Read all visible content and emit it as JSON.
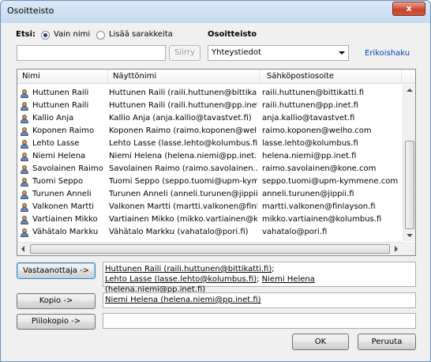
{
  "window": {
    "title": "Osoitteisto",
    "close": "x"
  },
  "search": {
    "label": "Etsi:",
    "opt_name": "Vain nimi",
    "opt_more": "Lisää sarakkeita",
    "value": "",
    "go_label": "Siirry"
  },
  "book": {
    "label": "Osoitteisto",
    "selected": "Yhteystiedot",
    "advanced": "Erikoishaku"
  },
  "columns": [
    "Nimi",
    "Näyttönimi",
    "Sähköpostiosoite"
  ],
  "rows": [
    {
      "name": "Huttunen Raili",
      "display": "Huttunen Raili (raili.huttunen@bittika...",
      "email": "raili.huttunen@bittikatti.fi"
    },
    {
      "name": "Huttunen Raili",
      "display": "Huttunen Raili (raili.huttunen@pp.inet....",
      "email": "raili.huttunen@pp.inet.fi"
    },
    {
      "name": "Kallio Anja",
      "display": "Kallio Anja (anja.kallio@tavastvet.fi)",
      "email": "anja.kallio@tavastvet.fi"
    },
    {
      "name": "Koponen Raimo",
      "display": "Koponen Raimo (raimo.koponen@wel...",
      "email": "raimo.koponen@welho.com"
    },
    {
      "name": "Lehto Lasse",
      "display": "Lehto Lasse (lasse.lehto@kolumbus.fi)",
      "email": "lasse.lehto@kolumbus.fi"
    },
    {
      "name": "Niemi Helena",
      "display": "Niemi Helena (helena.niemi@pp.inet.fi)",
      "email": "helena.niemi@pp.inet.fi"
    },
    {
      "name": "Savolainen Raimo",
      "display": "Savolainen Raimo (raimo.savolainen....",
      "email": "raimo.savolainen@kone.com"
    },
    {
      "name": "Tuomi Seppo",
      "display": "Tuomi Seppo (seppo.tuomi@upm-kym...",
      "email": "seppo.tuomi@upm-kymmene.com"
    },
    {
      "name": "Turunen Anneli",
      "display": "Turunen Anneli (anneli.turunen@jippii...",
      "email": "anneli.turunen@jippii.fi"
    },
    {
      "name": "Valkonen Martti",
      "display": "Valkonen Martti (martti.valkonen@finl...",
      "email": "martti.valkonen@finlayson.fi"
    },
    {
      "name": "Vartiainen Mikko",
      "display": "Vartiainen Mikko (mikko.vartiainen@k...",
      "email": "mikko.vartiainen@kolumbus.fi"
    },
    {
      "name": "Vähätalo Markku",
      "display": "Vähätalo Markku (vahatalo@pori.fi)",
      "email": "vahatalo@pori.fi"
    }
  ],
  "recipients": {
    "to_label": "Vastaanottaja ->",
    "to_1": "Huttunen Raili (raili.huttunen@bittikatti.fi)",
    "sep1": ";",
    "to_2": "Lehto Lasse (lasse.lehto@kolumbus.fi)",
    "sep2": ";",
    "to_3": "Niemi Helena (helena.niemi@pp.inet.fi)",
    "cc_label": "Kopio ->",
    "cc_1": "Niemi Helena (helena.niemi@pp.inet.fi)",
    "bcc_label": "Piilokopio ->",
    "bcc_value": ""
  },
  "footer": {
    "ok": "OK",
    "cancel": "Peruuta"
  },
  "colors": {
    "title_bg": "#c4d9f0",
    "close_red": "#c9432a",
    "link": "#0645ad"
  },
  "icons": {
    "contact": "person-icon"
  }
}
